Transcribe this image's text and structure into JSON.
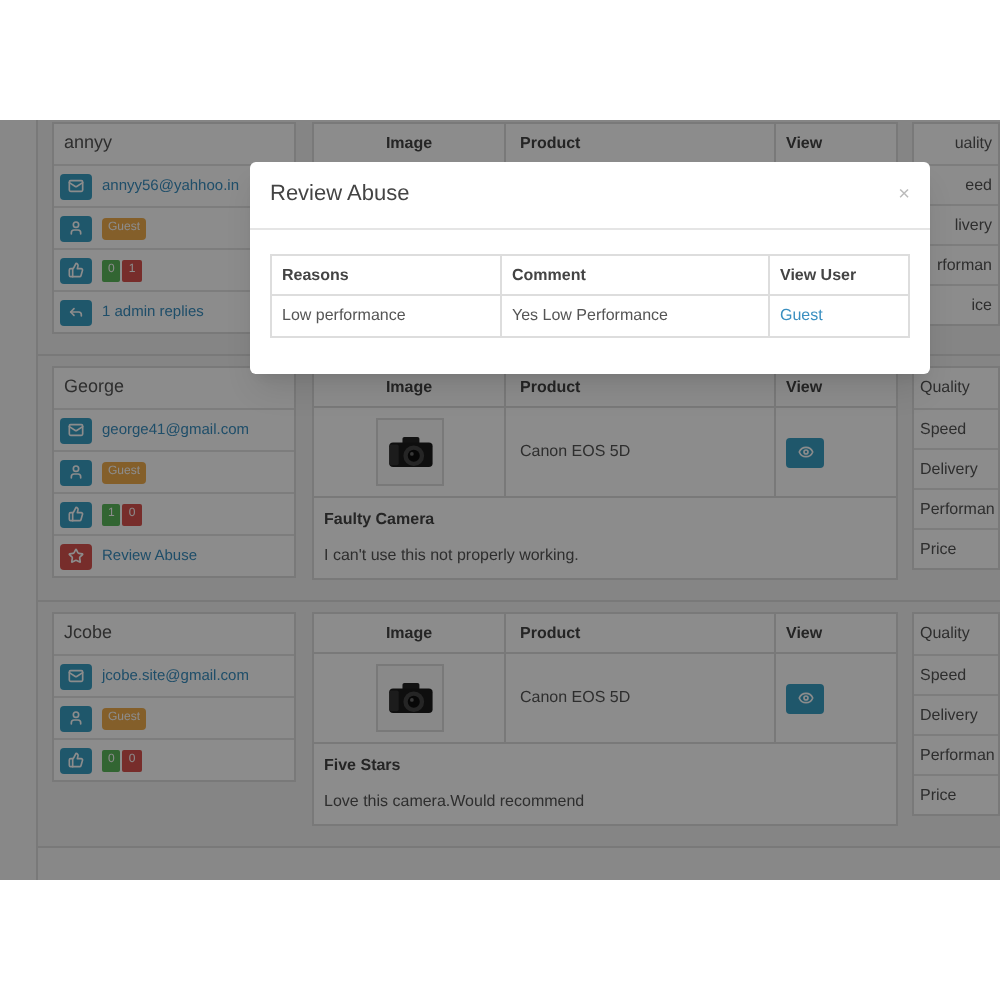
{
  "reviews": [
    {
      "user": {
        "name": "annyy",
        "rows": [
          {
            "kind": "email",
            "text": "annyy56@yahhoo.in"
          },
          {
            "kind": "role",
            "badge": "Guest"
          },
          {
            "kind": "votes",
            "up": "0",
            "down": "1"
          },
          {
            "kind": "replies",
            "text": "1 admin replies"
          }
        ]
      },
      "table": {
        "columns": [
          "Image",
          "Product",
          "View"
        ]
      },
      "ratings": {
        "partial": true,
        "labels": [
          "uality",
          "eed",
          "livery",
          "rforman",
          "ice"
        ]
      }
    },
    {
      "user": {
        "name": "George",
        "rows": [
          {
            "kind": "email",
            "text": "george41@gmail.com"
          },
          {
            "kind": "role",
            "badge": "Guest"
          },
          {
            "kind": "votes",
            "up": "1",
            "down": "0"
          },
          {
            "kind": "abuse",
            "text": "Review Abuse"
          }
        ]
      },
      "table": {
        "columns": [
          "Image",
          "Product",
          "View"
        ],
        "product": "Canon EOS 5D",
        "title": "Faulty Camera",
        "text": "I can't use this not properly working."
      },
      "ratings": {
        "partial": false,
        "labels": [
          "Quality",
          "Speed",
          "Delivery",
          "Performan",
          "Price"
        ]
      }
    },
    {
      "user": {
        "name": "Jcobe",
        "rows": [
          {
            "kind": "email",
            "text": "jcobe.site@gmail.com"
          },
          {
            "kind": "role",
            "badge": "Guest"
          },
          {
            "kind": "votes",
            "up": "0",
            "down": "0"
          }
        ]
      },
      "table": {
        "columns": [
          "Image",
          "Product",
          "View"
        ],
        "product": "Canon EOS 5D",
        "title": "Five Stars",
        "text": "Love this camera.Would recommend"
      },
      "ratings": {
        "partial": false,
        "labels": [
          "Quality",
          "Speed",
          "Delivery",
          "Performan",
          "Price"
        ]
      }
    }
  ],
  "modal": {
    "title": "Review Abuse",
    "close": "×",
    "columns": [
      "Reasons",
      "Comment",
      "View User"
    ],
    "rows": [
      {
        "reason": "Low performance",
        "comment": "Yes Low Performance",
        "user": "Guest"
      }
    ]
  }
}
